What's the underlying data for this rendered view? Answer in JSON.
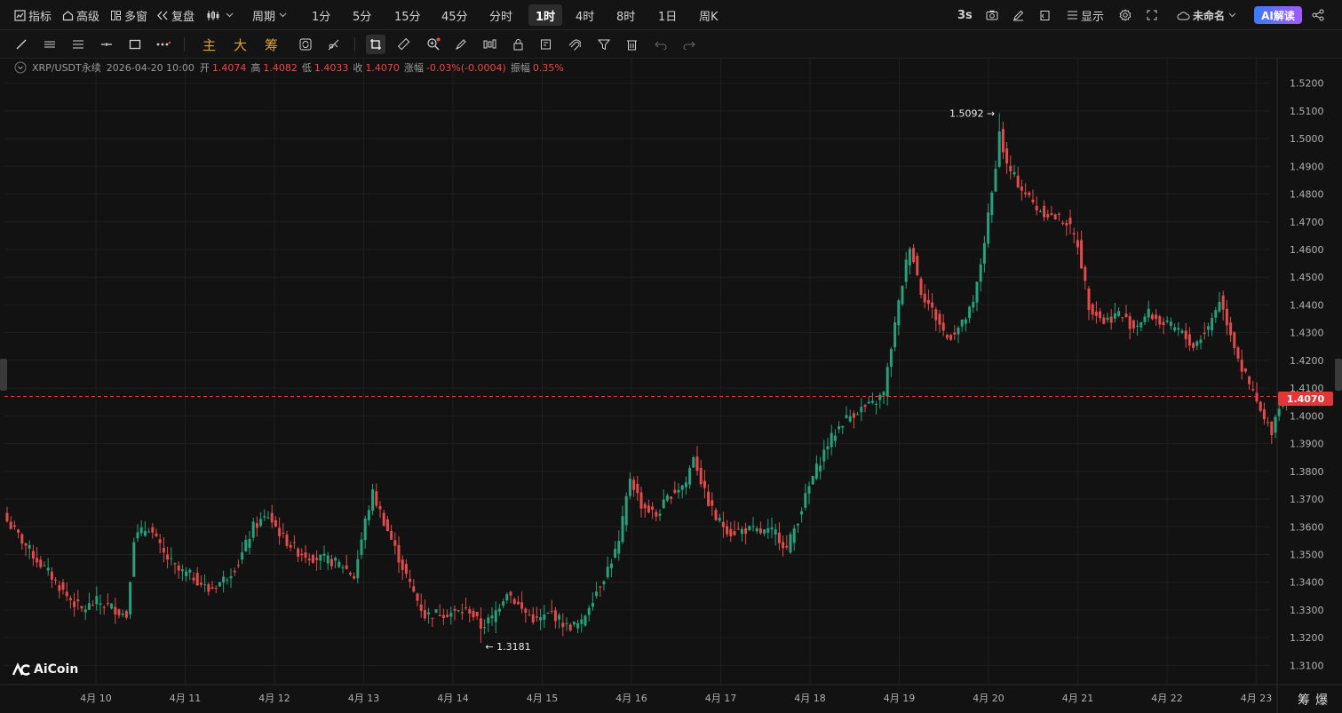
{
  "toolbar": {
    "indicator": "指标",
    "advanced": "高级",
    "multi_window": "多窗",
    "replay": "复盘",
    "period": "周期",
    "intervals": [
      "1分",
      "5分",
      "15分",
      "45分",
      "分时",
      "1时",
      "4时",
      "8时",
      "1日",
      "周K"
    ],
    "active_interval": "1时",
    "refresh": "3s",
    "display": "显示",
    "layout_name": "未命名",
    "ai_button": "AI解读"
  },
  "drawing_tools": {
    "main": "主",
    "large": "大",
    "chips": "筹"
  },
  "info": {
    "symbol": "XRP/USDT永续",
    "datetime": "2026-04-20 10:00",
    "open_label": "开",
    "open": "1.4074",
    "high_label": "高",
    "high": "1.4082",
    "low_label": "低",
    "low": "1.4033",
    "close_label": "收",
    "close": "1.4070",
    "change_label": "涨幅",
    "change": "-0.03%(-0.0004)",
    "amplitude_label": "振幅",
    "amplitude": "0.35%"
  },
  "colors": {
    "up": "#26a17b",
    "down": "#e24b4b",
    "background": "#121212"
  },
  "chart_data": {
    "type": "candlestick",
    "symbol": "XRP/USDT永续",
    "interval": "1时",
    "ylim": [
      1.305,
      1.525
    ],
    "y_ticks": [
      "1.5200",
      "1.5100",
      "1.5000",
      "1.4900",
      "1.4800",
      "1.4700",
      "1.4600",
      "1.4500",
      "1.4400",
      "1.4300",
      "1.4200",
      "1.4100",
      "1.4000",
      "1.3900",
      "1.3800",
      "1.3700",
      "1.3600",
      "1.3500",
      "1.3400",
      "1.3300",
      "1.3200",
      "1.3100"
    ],
    "x_ticks": [
      "4月 10",
      "4月 11",
      "4月 12",
      "4月 13",
      "4月 14",
      "4月 15",
      "4月 16",
      "4月 17",
      "4月 18",
      "4月 19",
      "4月 20",
      "4月 21",
      "4月 22",
      "4月 23"
    ],
    "last_price": "1.4070",
    "max_label": "1.5092",
    "min_label": "1.3181",
    "close_path": [
      [
        0,
        1.362
      ],
      [
        4,
        1.355
      ],
      [
        8,
        1.348
      ],
      [
        12,
        1.342
      ],
      [
        16,
        1.335
      ],
      [
        20,
        1.33
      ],
      [
        24,
        1.333
      ],
      [
        28,
        1.331
      ],
      [
        32,
        1.328
      ],
      [
        34,
        1.356
      ],
      [
        38,
        1.36
      ],
      [
        42,
        1.35
      ],
      [
        46,
        1.344
      ],
      [
        50,
        1.342
      ],
      [
        54,
        1.337
      ],
      [
        58,
        1.341
      ],
      [
        62,
        1.347
      ],
      [
        66,
        1.36
      ],
      [
        70,
        1.364
      ],
      [
        74,
        1.356
      ],
      [
        78,
        1.351
      ],
      [
        82,
        1.349
      ],
      [
        86,
        1.348
      ],
      [
        90,
        1.346
      ],
      [
        93,
        1.342
      ],
      [
        96,
        1.362
      ],
      [
        98,
        1.372
      ],
      [
        101,
        1.362
      ],
      [
        104,
        1.352
      ],
      [
        108,
        1.339
      ],
      [
        112,
        1.328
      ],
      [
        116,
        1.329
      ],
      [
        120,
        1.329
      ],
      [
        124,
        1.33
      ],
      [
        127,
        1.324
      ],
      [
        130,
        1.327
      ],
      [
        134,
        1.337
      ],
      [
        138,
        1.33
      ],
      [
        142,
        1.326
      ],
      [
        146,
        1.329
      ],
      [
        150,
        1.324
      ],
      [
        154,
        1.325
      ],
      [
        156,
        1.332
      ],
      [
        160,
        1.342
      ],
      [
        164,
        1.354
      ],
      [
        167,
        1.378
      ],
      [
        170,
        1.368
      ],
      [
        174,
        1.364
      ],
      [
        178,
        1.372
      ],
      [
        182,
        1.376
      ],
      [
        184,
        1.386
      ],
      [
        187,
        1.372
      ],
      [
        190,
        1.363
      ],
      [
        194,
        1.358
      ],
      [
        198,
        1.359
      ],
      [
        202,
        1.358
      ],
      [
        206,
        1.358
      ],
      [
        209,
        1.352
      ],
      [
        212,
        1.363
      ],
      [
        216,
        1.378
      ],
      [
        220,
        1.39
      ],
      [
        224,
        1.398
      ],
      [
        228,
        1.402
      ],
      [
        232,
        1.404
      ],
      [
        235,
        1.408
      ],
      [
        237,
        1.425
      ],
      [
        240,
        1.448
      ],
      [
        242,
        1.462
      ],
      [
        245,
        1.445
      ],
      [
        248,
        1.438
      ],
      [
        252,
        1.428
      ],
      [
        256,
        1.433
      ],
      [
        259,
        1.44
      ],
      [
        261,
        1.455
      ],
      [
        264,
        1.48
      ],
      [
        266,
        1.502
      ],
      [
        268,
        1.49
      ],
      [
        272,
        1.482
      ],
      [
        276,
        1.475
      ],
      [
        280,
        1.472
      ],
      [
        284,
        1.47
      ],
      [
        287,
        1.462
      ],
      [
        290,
        1.44
      ],
      [
        294,
        1.434
      ],
      [
        298,
        1.437
      ],
      [
        302,
        1.432
      ],
      [
        306,
        1.437
      ],
      [
        310,
        1.433
      ],
      [
        314,
        1.431
      ],
      [
        318,
        1.425
      ],
      [
        322,
        1.432
      ],
      [
        325,
        1.442
      ],
      [
        328,
        1.43
      ],
      [
        331,
        1.417
      ],
      [
        334,
        1.408
      ],
      [
        337,
        1.398
      ],
      [
        339,
        1.395
      ],
      [
        341,
        1.404
      ],
      [
        343,
        1.407
      ]
    ]
  }
}
